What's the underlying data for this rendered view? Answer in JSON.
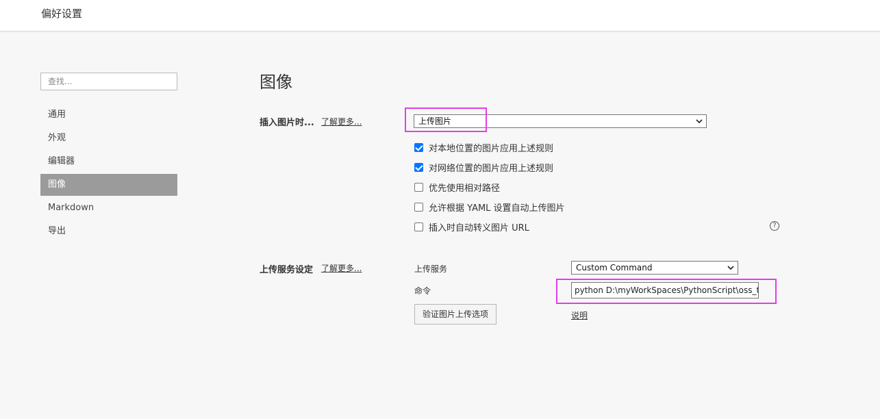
{
  "window": {
    "title": "偏好设置"
  },
  "sidebar": {
    "search_placeholder": "查找...",
    "items": [
      {
        "label": "通用",
        "active": false
      },
      {
        "label": "外观",
        "active": false
      },
      {
        "label": "编辑器",
        "active": false
      },
      {
        "label": "图像",
        "active": true
      },
      {
        "label": "Markdown",
        "active": false
      },
      {
        "label": "导出",
        "active": false
      }
    ]
  },
  "main": {
    "heading": "图像",
    "insert": {
      "label": "插入图片时...",
      "learn_more": "了解更多...",
      "selected_action": "上传图片",
      "options": [
        {
          "label": "对本地位置的图片应用上述规则",
          "checked": true
        },
        {
          "label": "对网络位置的图片应用上述规则",
          "checked": true
        },
        {
          "label": "优先使用相对路径",
          "checked": false
        },
        {
          "label": "允许根据 YAML 设置自动上传图片",
          "checked": false
        },
        {
          "label": "插入时自动转义图片 URL",
          "checked": false
        }
      ],
      "help_icon": "help-circle-icon"
    },
    "upload": {
      "label": "上传服务设定",
      "learn_more": "了解更多...",
      "service_label": "上传服务",
      "service_value": "Custom Command",
      "command_label": "命令",
      "command_value": "python D:\\myWorkSpaces\\PythonScript\\oss_typora",
      "verify_button": "验证图片上传选项",
      "docs_link": "说明"
    }
  },
  "annotation_color": "#e03ee6"
}
